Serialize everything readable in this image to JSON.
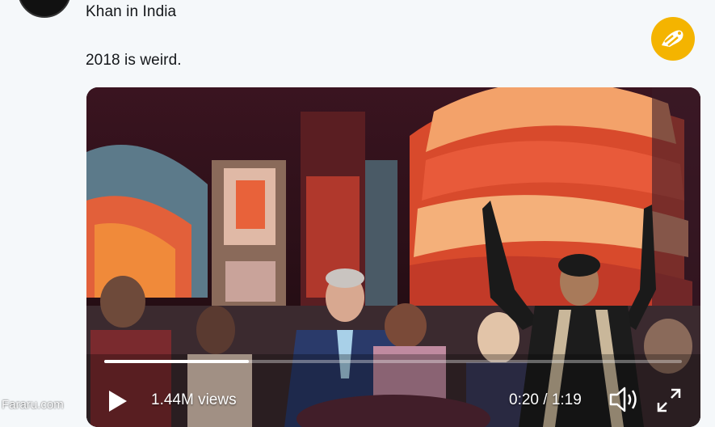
{
  "tweet": {
    "line1": "Khan in India",
    "line2": "2018 is weird."
  },
  "video": {
    "views": "1.44M views",
    "time": "0:20 / 1:19",
    "progress": 0.25
  },
  "watermark": "Fararu.com",
  "icons": {
    "play": "play-icon",
    "volume": "volume-icon",
    "fullscreen": "fullscreen-icon",
    "logo": "publisher-logo"
  },
  "colors": {
    "logo_bg": "#f4b400",
    "page_bg": "#f5f8fa",
    "text": "#14171a"
  }
}
